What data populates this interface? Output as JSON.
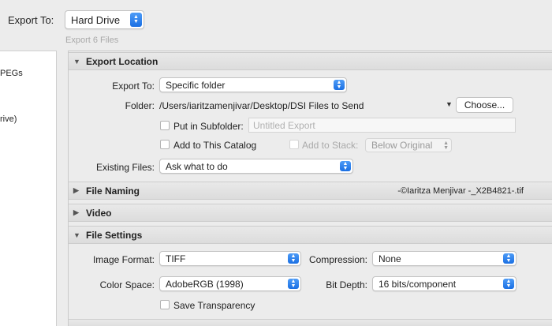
{
  "top": {
    "export_to_label": "Export To:",
    "export_to_value": "Hard Drive",
    "export_count": "Export 6 Files"
  },
  "left_panel": {
    "items": [
      "PEGs",
      "rive)"
    ]
  },
  "export_location": {
    "header": "Export Location",
    "export_to_label": "Export To:",
    "export_to_value": "Specific folder",
    "folder_label": "Folder:",
    "folder_path": "/Users/iaritzamenjivar/Desktop/DSI Files to Send",
    "choose_label": "Choose...",
    "subfolder_label": "Put in Subfolder:",
    "subfolder_placeholder": "Untitled Export",
    "add_catalog_label": "Add to This Catalog",
    "add_stack_label": "Add to Stack:",
    "stack_position": "Below Original",
    "existing_files_label": "Existing Files:",
    "existing_files_value": "Ask what to do"
  },
  "file_naming": {
    "header": "File Naming",
    "example": "-©Iaritza Menjivar -_X2B4821-.tif"
  },
  "video": {
    "header": "Video"
  },
  "file_settings": {
    "header": "File Settings",
    "image_format_label": "Image Format:",
    "image_format_value": "TIFF",
    "compression_label": "Compression:",
    "compression_value": "None",
    "color_space_label": "Color Space:",
    "color_space_value": "AdobeRGB (1998)",
    "bit_depth_label": "Bit Depth:",
    "bit_depth_value": "16 bits/component",
    "save_transparency_label": "Save Transparency"
  },
  "colors": {
    "accent": "#1a6fe3",
    "background": "#ececec"
  }
}
